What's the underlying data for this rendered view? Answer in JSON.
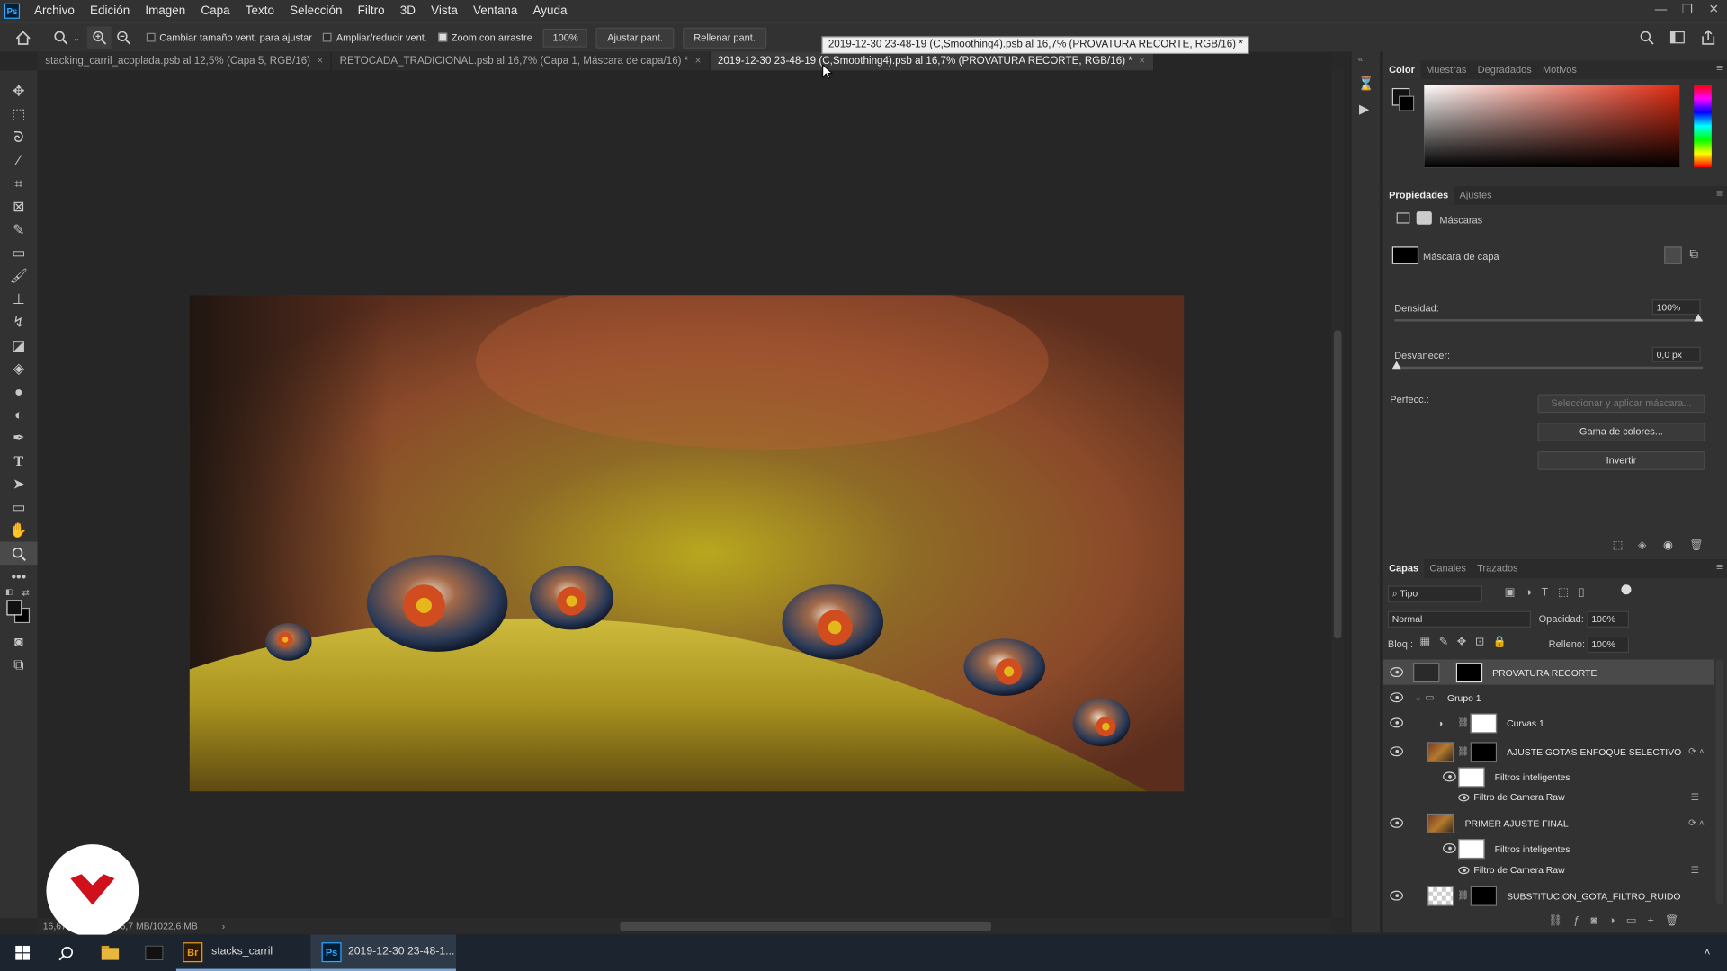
{
  "app": {
    "logo": "Ps"
  },
  "menu": [
    "Archivo",
    "Edición",
    "Imagen",
    "Capa",
    "Texto",
    "Selección",
    "Filtro",
    "3D",
    "Vista",
    "Ventana",
    "Ayuda"
  ],
  "options": {
    "resize_windows": "Cambiar tamaño vent. para ajustar",
    "zoom_all": "Ampliar/reducir vent.",
    "scrubby_zoom": "Zoom con arrastre",
    "zoom_value": "100%",
    "fit_screen": "Ajustar pant.",
    "fill_screen": "Rellenar pant."
  },
  "tabs": [
    {
      "label": "stacking_carril_acoplada.psb al 12,5% (Capa 5, RGB/16)",
      "close": "×"
    },
    {
      "label": "RETOCADA_TRADICIONAL.psb al 16,7% (Capa 1, Máscara de capa/16) *",
      "close": "×"
    },
    {
      "label": "2019-12-30 23-48-19 (C,Smoothing4).psb al 16,7% (PROVATURA RECORTE, RGB/16) *",
      "close": "×"
    }
  ],
  "tooltip": "2019-12-30 23-48-19 (C,Smoothing4).psb al 16,7% (PROVATURA RECORTE, RGB/16) *",
  "status": {
    "zoom": "16,67%",
    "doc": "Doc: 206,7 MB/1022,6 MB",
    "arrow": "›"
  },
  "color_panel": {
    "tabs": [
      "Color",
      "Muestras",
      "Degradados",
      "Motivos"
    ],
    "hue_color": "#e02a10"
  },
  "properties": {
    "tabs": [
      "Propiedades",
      "Ajustes"
    ],
    "section": "Máscaras",
    "mask_label": "Máscara de capa",
    "density_label": "Densidad:",
    "density_value": "100%",
    "feather_label": "Desvanecer:",
    "feather_value": "0,0 px",
    "refine_label": "Perfecc.:",
    "select_mask": "Seleccionar y aplicar máscara...",
    "color_range": "Gama de colores...",
    "invert": "Invertir"
  },
  "layers_panel": {
    "tabs": [
      "Capas",
      "Canales",
      "Trazados"
    ],
    "filter_kind": "Tipo",
    "blend_mode": "Normal",
    "opacity_label": "Opacidad:",
    "opacity_value": "100%",
    "lock_label": "Bloq.:",
    "fill_label": "Relleno:",
    "fill_value": "100%",
    "layers": [
      {
        "name": "PROVATURA RECORTE"
      },
      {
        "name": "Grupo 1"
      },
      {
        "name": "Curvas 1"
      },
      {
        "name": "AJUSTE GOTAS ENFOQUE SELECTIVO"
      },
      {
        "name": "Filtros inteligentes"
      },
      {
        "name": "Filtro de Camera Raw"
      },
      {
        "name": "PRIMER AJUSTE FINAL"
      },
      {
        "name": "Filtros inteligentes"
      },
      {
        "name": "Filtro de Camera Raw"
      },
      {
        "name": "SUBSTITUCION_GOTA_FILTRO_RUIDO"
      }
    ]
  },
  "taskbar": {
    "bridge_label": "stacks_carril",
    "ps_label": "2019-12-30 23-48-1..."
  }
}
